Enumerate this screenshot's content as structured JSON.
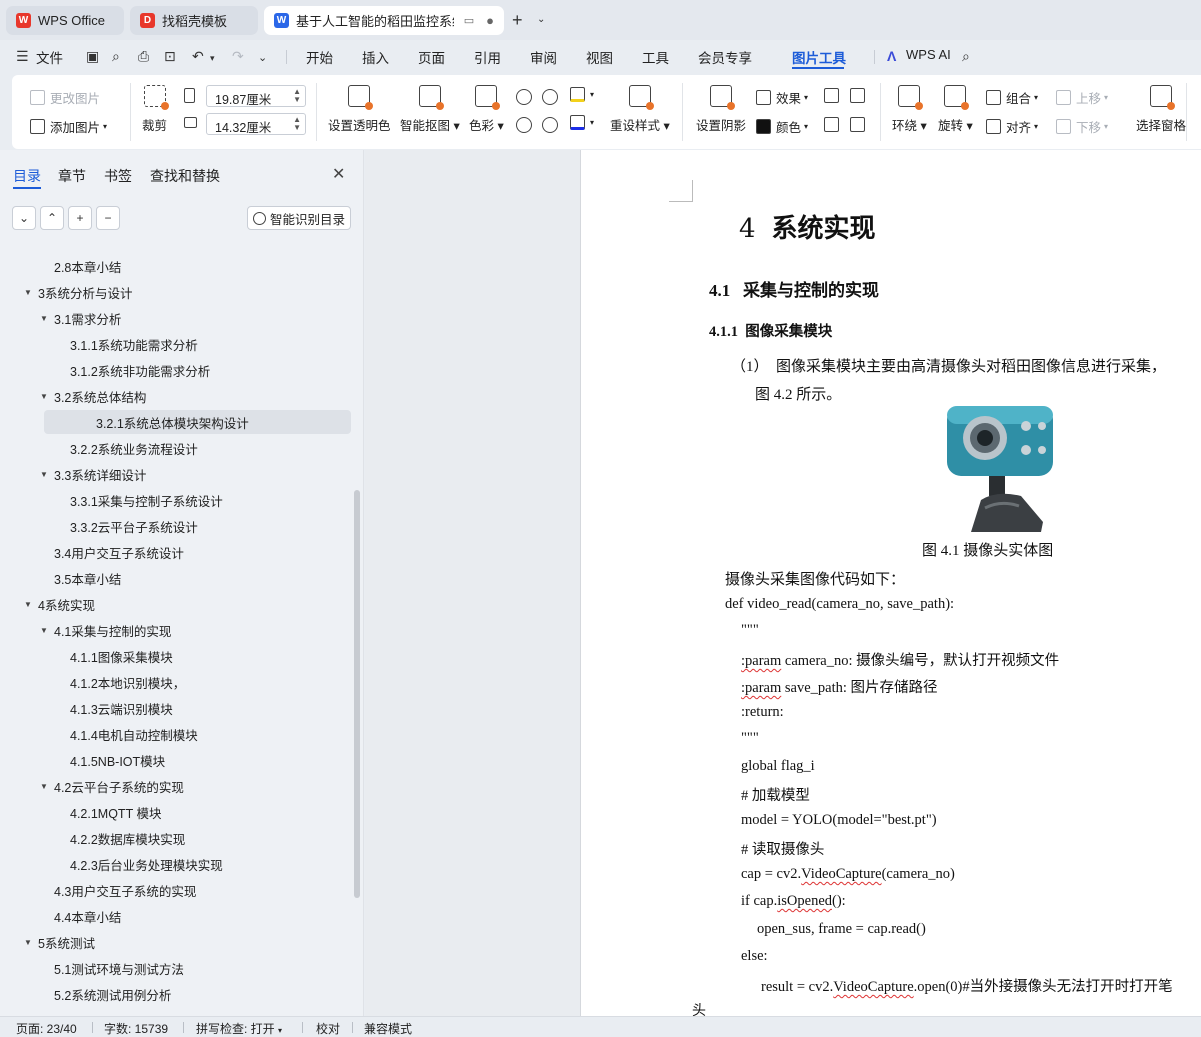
{
  "tabs": [
    {
      "label": "WPS Office",
      "icon": "wps-logo-icon",
      "color": "#e8372b"
    },
    {
      "label": "找稻壳模板",
      "icon": "docer-logo-icon",
      "color": "#e8372b"
    },
    {
      "label": "基于人工智能的稻田监控系统",
      "icon": "word-doc-icon",
      "color": "#2b67e8"
    }
  ],
  "newtab": {
    "plus": "+",
    "dropdown": "⌄"
  },
  "menubar": {
    "file": "文件",
    "items": [
      "开始",
      "插入",
      "页面",
      "引用",
      "审阅",
      "视图",
      "工具",
      "会员专享",
      "图片工具"
    ],
    "active": "图片工具",
    "ai": "WPS AI"
  },
  "ribbon": {
    "change_image": "更改图片",
    "add_image": "添加图片",
    "crop": "裁剪",
    "crop_btn": "裁剪",
    "width_value": "19.87厘米",
    "height_value": "14.32厘米",
    "transparent": "设置透明色",
    "smart_cutout": "智能抠图",
    "color": "色彩",
    "reset_style": "重设样式",
    "shadow": "设置阴影",
    "effects": "效果",
    "border_color": "颜色",
    "wrap": "环绕",
    "rotate": "旋转",
    "group": "组合",
    "align": "对齐",
    "move_up": "上移",
    "move_down": "下移",
    "selection_pane": "选择窗格"
  },
  "nav": {
    "tabs": [
      "目录",
      "章节",
      "书签",
      "查找和替换"
    ],
    "active_tab": "目录",
    "close": "✕",
    "smart_button": "智能识别目录",
    "controls": [
      "⌄",
      "⌃",
      "+",
      "−"
    ],
    "toc": [
      {
        "label": "2.8本章小结",
        "level": 2,
        "expand": ""
      },
      {
        "label": "3系统分析与设计",
        "level": 1,
        "expand": "▼"
      },
      {
        "label": "3.1需求分析",
        "level": 2,
        "expand": "▼"
      },
      {
        "label": "3.1.1系统功能需求分析",
        "level": 3,
        "expand": ""
      },
      {
        "label": "3.1.2系统非功能需求分析",
        "level": 3,
        "expand": ""
      },
      {
        "label": "3.2系统总体结构",
        "level": 2,
        "expand": "▼"
      },
      {
        "label": "3.2.1系统总体模块架构设计",
        "level": 3,
        "expand": "",
        "selected": true
      },
      {
        "label": "3.2.2系统业务流程设计",
        "level": 3,
        "expand": ""
      },
      {
        "label": "3.3系统详细设计",
        "level": 2,
        "expand": "▼"
      },
      {
        "label": "3.3.1采集与控制子系统设计",
        "level": 3,
        "expand": ""
      },
      {
        "label": "3.3.2云平台子系统设计",
        "level": 3,
        "expand": ""
      },
      {
        "label": "3.4用户交互子系统设计",
        "level": 2,
        "expand": ""
      },
      {
        "label": "3.5本章小结",
        "level": 2,
        "expand": ""
      },
      {
        "label": "4系统实现",
        "level": 1,
        "expand": "▼"
      },
      {
        "label": "4.1采集与控制的实现",
        "level": 2,
        "expand": "▼"
      },
      {
        "label": "4.1.1图像采集模块",
        "level": 3,
        "expand": ""
      },
      {
        "label": "4.1.2本地识别模块，",
        "level": 3,
        "expand": ""
      },
      {
        "label": "4.1.3云端识别模块",
        "level": 3,
        "expand": ""
      },
      {
        "label": "4.1.4电机自动控制模块",
        "level": 3,
        "expand": ""
      },
      {
        "label": "4.1.5NB-IOT模块",
        "level": 3,
        "expand": ""
      },
      {
        "label": "4.2云平台子系统的实现",
        "level": 2,
        "expand": "▼"
      },
      {
        "label": "4.2.1MQTT 模块",
        "level": 3,
        "expand": ""
      },
      {
        "label": "4.2.2数据库模块实现",
        "level": 3,
        "expand": ""
      },
      {
        "label": "4.2.3后台业务处理模块实现",
        "level": 3,
        "expand": ""
      },
      {
        "label": "4.3用户交互子系统的实现",
        "level": 2,
        "expand": ""
      },
      {
        "label": "4.4本章小结",
        "level": 2,
        "expand": ""
      },
      {
        "label": "5系统测试",
        "level": 1,
        "expand": "▼"
      },
      {
        "label": "5.1测试环境与测试方法",
        "level": 2,
        "expand": ""
      },
      {
        "label": "5.2系统测试用例分析",
        "level": 2,
        "expand": ""
      }
    ]
  },
  "document": {
    "chapter_num": "4",
    "chapter_title": "系统实现",
    "h2_num": "4.1",
    "h2_title": "采集与控制的实现",
    "h3_num": "4.1.1",
    "h3_title": "图像采集模块",
    "para1_line1": "（1）　图像采集模块主要由高清摄像头对稻田图像信息进行采集，",
    "para1_line2": "图  4.2 所示。",
    "figure_caption": "图  4.1 摄像头实体图",
    "code_intro": "摄像头采集图像代码如下：",
    "code": {
      "def": "def video_read(camera_no, save_path):",
      "doc_open": "\"\"\"",
      "param1_a": ":param",
      "param1_b": " camera_no: 摄像头编号，默认打开视频文件",
      "param2_a": ":param",
      "param2_b": " save_path: 图片存储路径",
      "ret": ":return:",
      "doc_close": "\"\"\"",
      "global": "global flag_i",
      "cmt1": "# 加载模型",
      "model": "model = YOLO(model=\"best.pt\")",
      "cmt2": "# 读取摄像头",
      "cap_a": "cap = cv2.",
      "cap_b": "VideoCapture",
      "cap_c": "(camera_no)",
      "if_a": "if cap.",
      "if_b": "isOpened",
      "if_c": "():",
      "read": "open_sus, frame = cap.read()",
      "else": "else:",
      "res_a": "result = cv2.",
      "res_b": "VideoCapture",
      "res_c": ".open(0)#当外接摄像头无法打开时打开笔"
    },
    "cursor_text": "头"
  },
  "status": {
    "page": "页面: 23/40",
    "words": "字数: 15739",
    "spell": "拼写检查: 打开",
    "proof": "校对",
    "compat": "兼容模式"
  }
}
